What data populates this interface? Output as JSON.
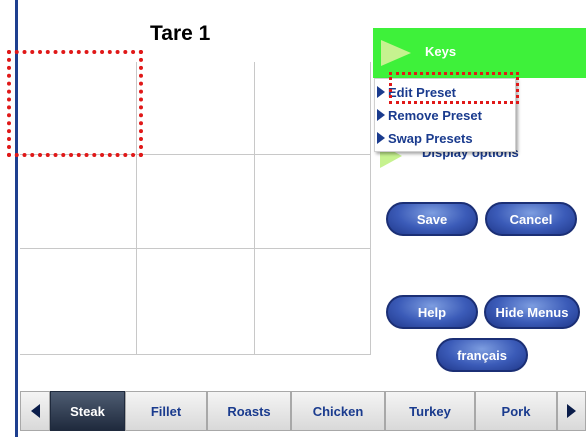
{
  "title": "Tare 1",
  "panel": {
    "keys_label": "Keys",
    "menu": [
      "Edit Preset",
      "Remove Preset",
      "Swap Presets"
    ],
    "display_options_label": "Display options"
  },
  "buttons": {
    "save": "Save",
    "cancel": "Cancel",
    "help": "Help",
    "hide_menus": "Hide Menus",
    "language": "français"
  },
  "tabs": [
    "Steak",
    "Fillet",
    "Roasts",
    "Chicken",
    "Turkey",
    "Pork"
  ],
  "active_tab": "Steak",
  "colors": {
    "accent_green": "#3ef13a",
    "brand_blue": "#1a3b8e",
    "highlight_red": "#e01818"
  }
}
